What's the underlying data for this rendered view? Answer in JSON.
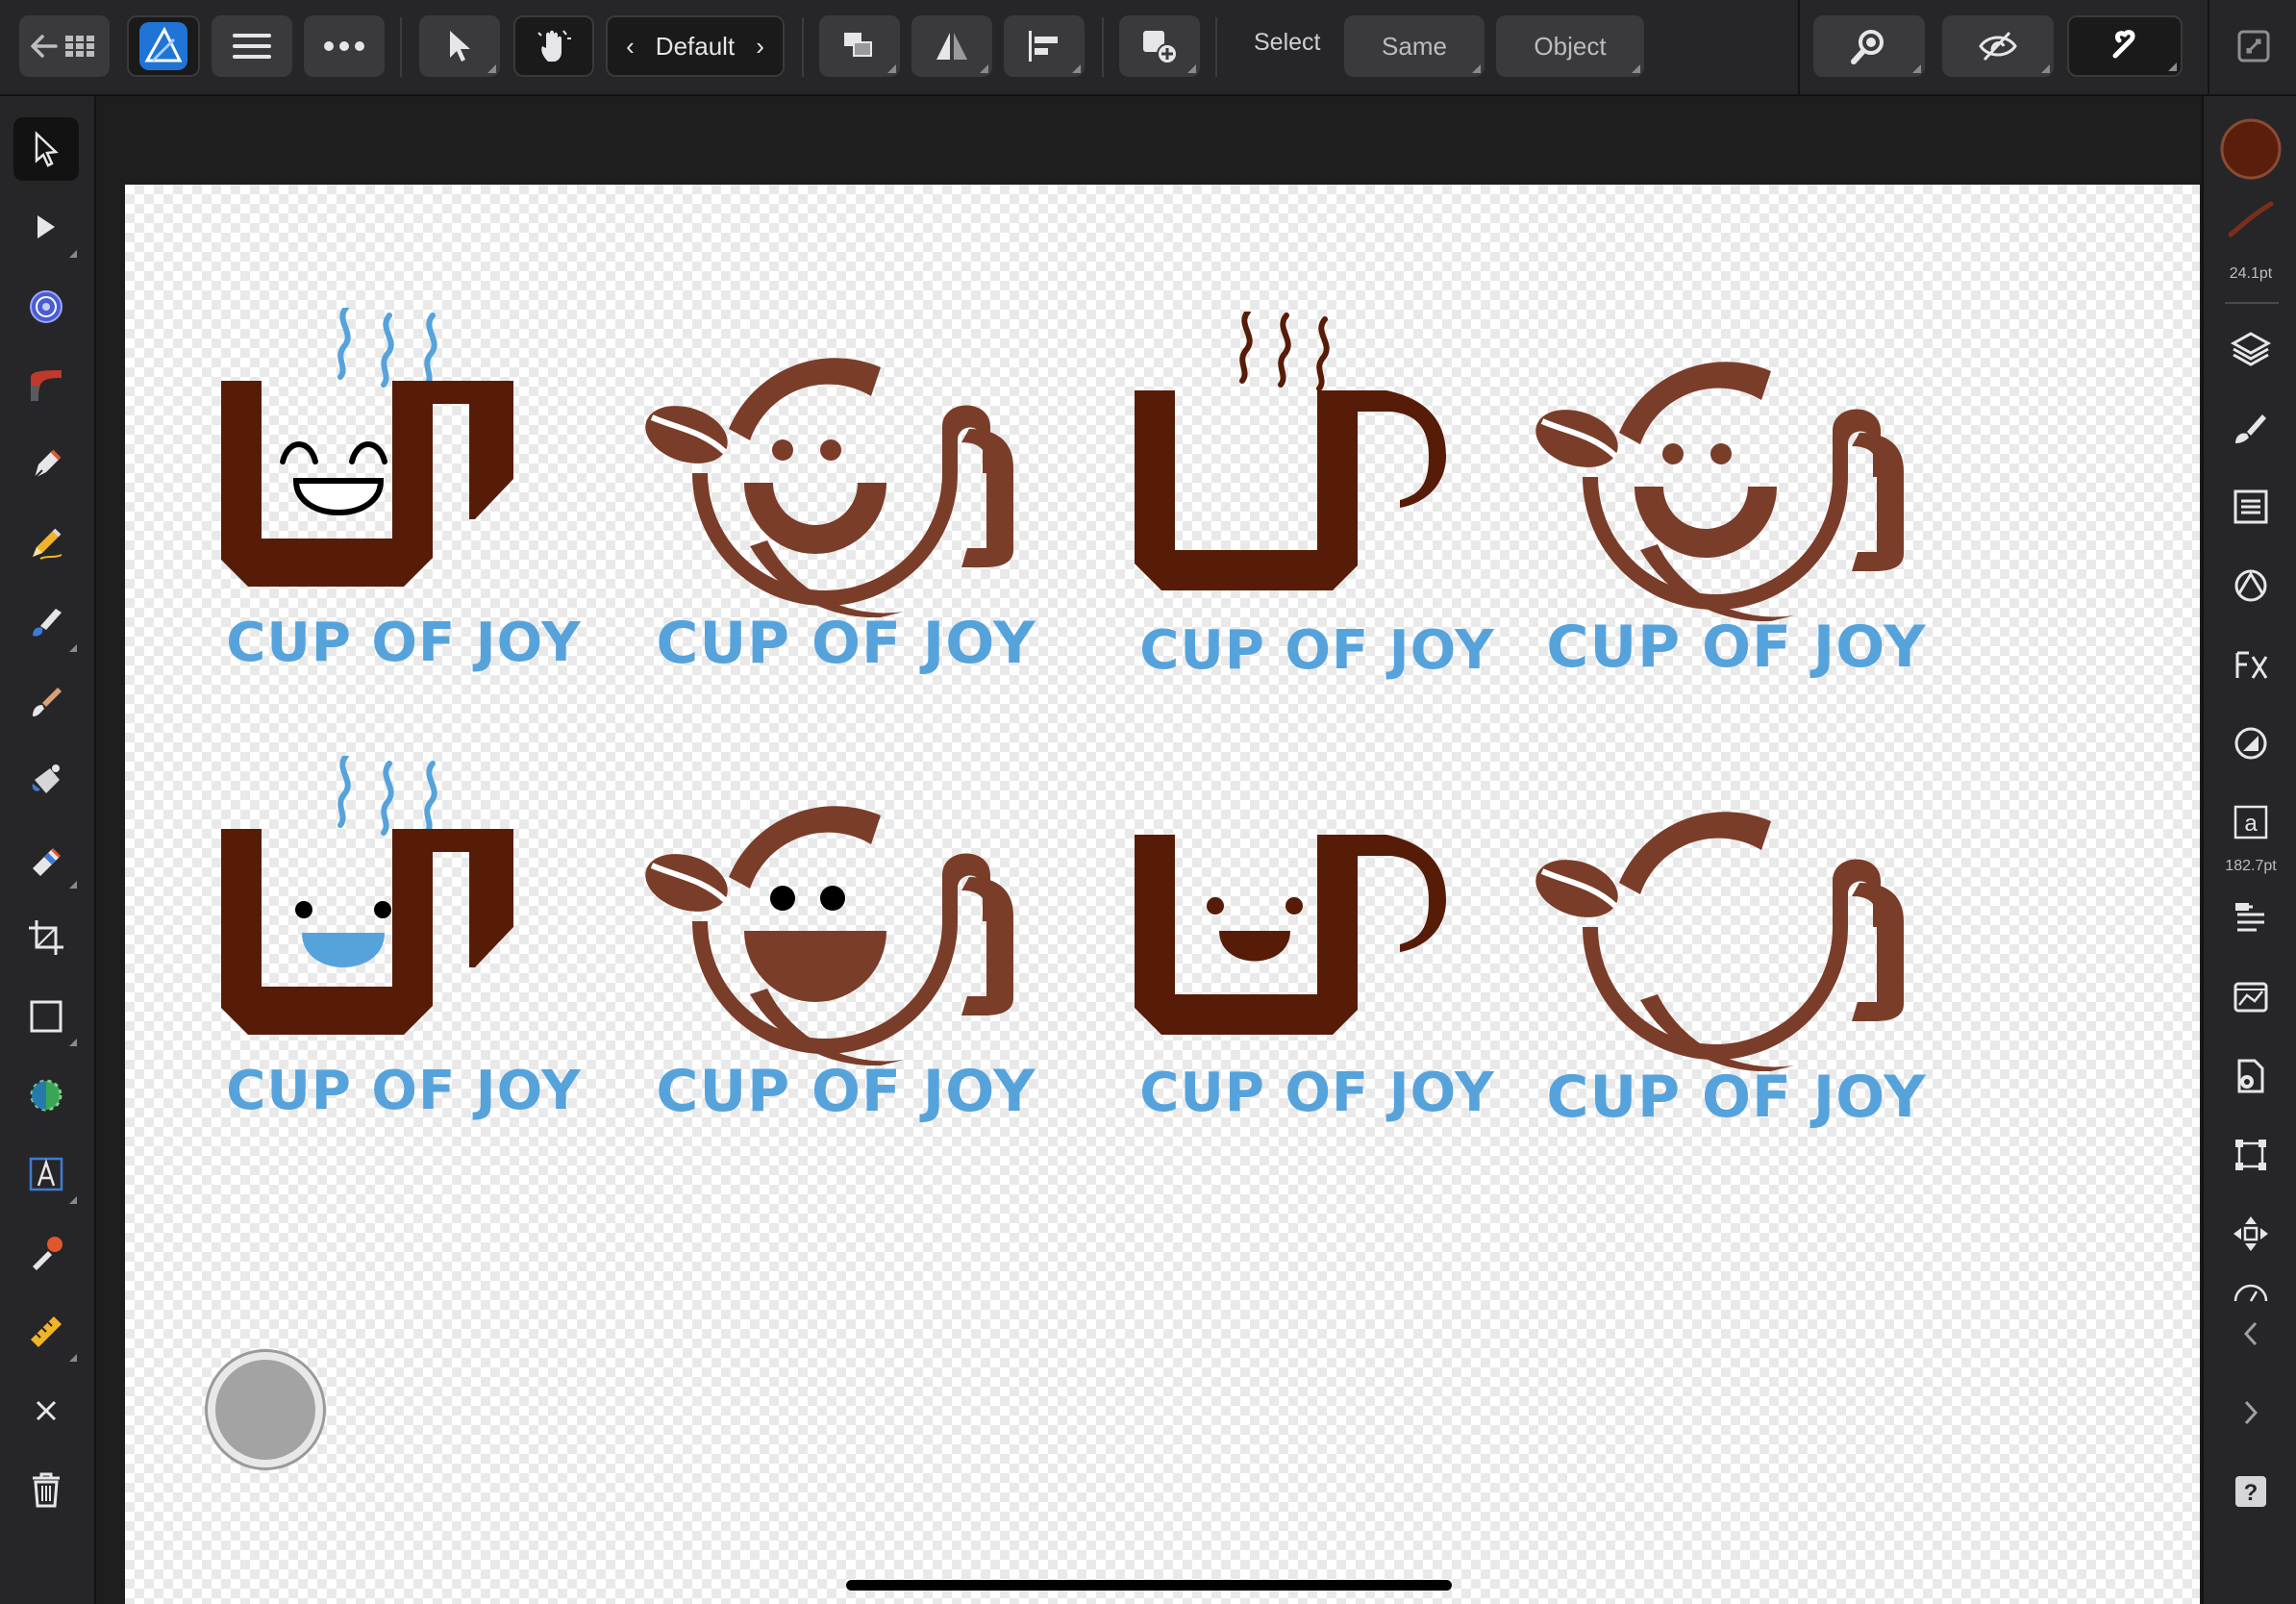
{
  "toolbar": {
    "persona_label": "Default",
    "select_label": "Select",
    "same_label": "Same",
    "object_label": "Object"
  },
  "studio": {
    "brush_width": "24.1pt",
    "font_size": "182.7pt"
  },
  "colors": {
    "primary_fill": "#5a1e0c",
    "cup_dark": "#561c08",
    "cup_medium": "#7a3d2a",
    "text_blue": "#56a3dc"
  },
  "logos": [
    {
      "text": "CUP OF JOY",
      "style": "square-cup-steam-laughing"
    },
    {
      "text": "CUP OF JOY",
      "style": "round-cup-bean-smile"
    },
    {
      "text": "CUP OF JOY",
      "style": "square-cup-dark-steam"
    },
    {
      "text": "CUP OF JOY",
      "style": "round-cup-bean-smile"
    },
    {
      "text": "CUP OF JOY",
      "style": "square-cup-steam-blue-smile"
    },
    {
      "text": "CUP OF JOY",
      "style": "round-cup-bean-open-mouth"
    },
    {
      "text": "CUP OF JOY",
      "style": "square-cup-face"
    },
    {
      "text": "CUP OF JOY",
      "style": "round-cup-bean-plain"
    }
  ],
  "icons": {
    "left_tools": [
      "move-icon",
      "node-icon",
      "fill-icon",
      "gradient-icon",
      "pen-icon",
      "pencil-icon",
      "vector-brush-icon",
      "paint-brush-icon",
      "paint-mixer-icon",
      "eraser-icon",
      "crop-icon",
      "rectangle-icon",
      "transparency-icon",
      "text-icon",
      "color-picker-icon",
      "measure-icon",
      "close-icon",
      "trash-icon"
    ],
    "right_tools": [
      "color-icon",
      "brush-stroke-icon",
      "layers-icon",
      "brushes-icon",
      "appearance-icon",
      "stroke-icon",
      "effects-icon",
      "fx-icon",
      "gradient-style-icon",
      "character-icon",
      "paragraph-icon",
      "navigator-icon",
      "document-icon",
      "transform-icon",
      "snapping-icon",
      "history-icon",
      "chevron-left-icon",
      "chevron-right-icon",
      "help-icon"
    ]
  }
}
